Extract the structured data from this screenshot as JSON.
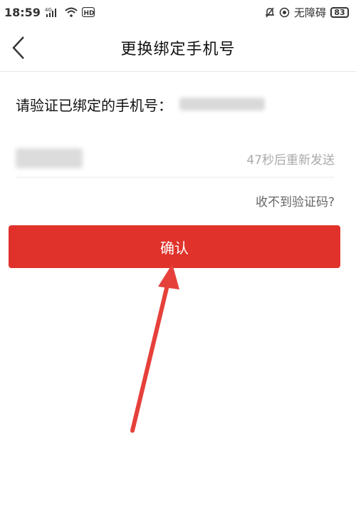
{
  "status_bar": {
    "time": "18:59",
    "network": "4G",
    "hd_label": "HD",
    "accessibility_label": "无障碍",
    "battery": "83"
  },
  "nav": {
    "title": "更换绑定手机号"
  },
  "verify": {
    "prompt": "请验证已绑定的手机号："
  },
  "code": {
    "resend_label": "47秒后重新发送"
  },
  "help": {
    "label": "收不到验证码?"
  },
  "actions": {
    "confirm_label": "确认"
  },
  "colors": {
    "accent": "#e0322b",
    "annotation_arrow": "#e6403a"
  }
}
